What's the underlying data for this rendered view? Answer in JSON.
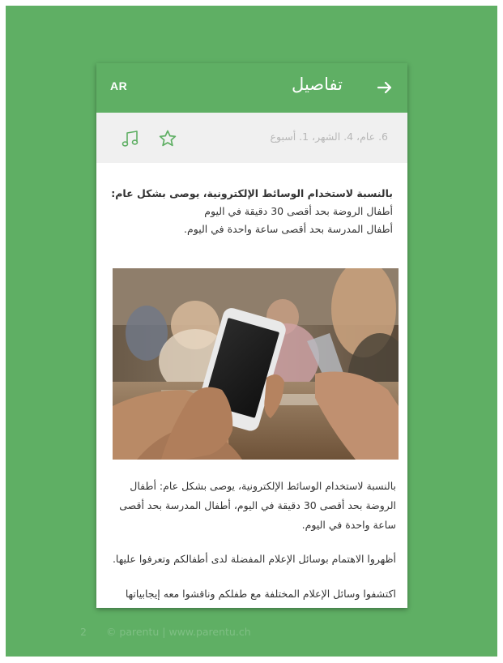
{
  "appbar": {
    "lang": "AR",
    "title": "تفاصيل",
    "back_icon": "arrow-right-icon"
  },
  "meta": {
    "age": "6. عام، 4. الشهر، 1. أسبوع",
    "favorite_icon": "star-outline-icon",
    "music_icon": "music-note-icon"
  },
  "content": {
    "intro_heading": "بالنسبة لاستخدام الوسائط الإلكترونية، يوصى بشكل عام:",
    "intro_lines": [
      "أطفال الروضة بحد أقصى 30 دقيقة في اليوم",
      "أطفال المدرسة بحد أقصى ساعة واحدة في اليوم."
    ],
    "image": "people-around-table-holding-smartphone",
    "paragraphs": [
      "بالنسبة لاستخدام الوسائط الإلكترونية، يوصى بشكل عام: أطفال الروضة بحد أقصى 30 دقيقة في اليوم، أطفال المدرسة بحد أقصى ساعة واحدة في اليوم.",
      "أظهروا الاهتمام بوسائل الإعلام المفضلة لدى أطفالكم وتعرفوا عليها.",
      "اكتشفوا وسائل الإعلام المختلفة مع طفلكم وناقشوا معه إيجابياتها"
    ]
  },
  "footer": {
    "page": "2",
    "credit": "© parentu | www.parentu.ch"
  },
  "colors": {
    "brand_green": "#5faf64",
    "meta_bg": "#f0f0f0",
    "meta_text": "#b7b7b7"
  }
}
